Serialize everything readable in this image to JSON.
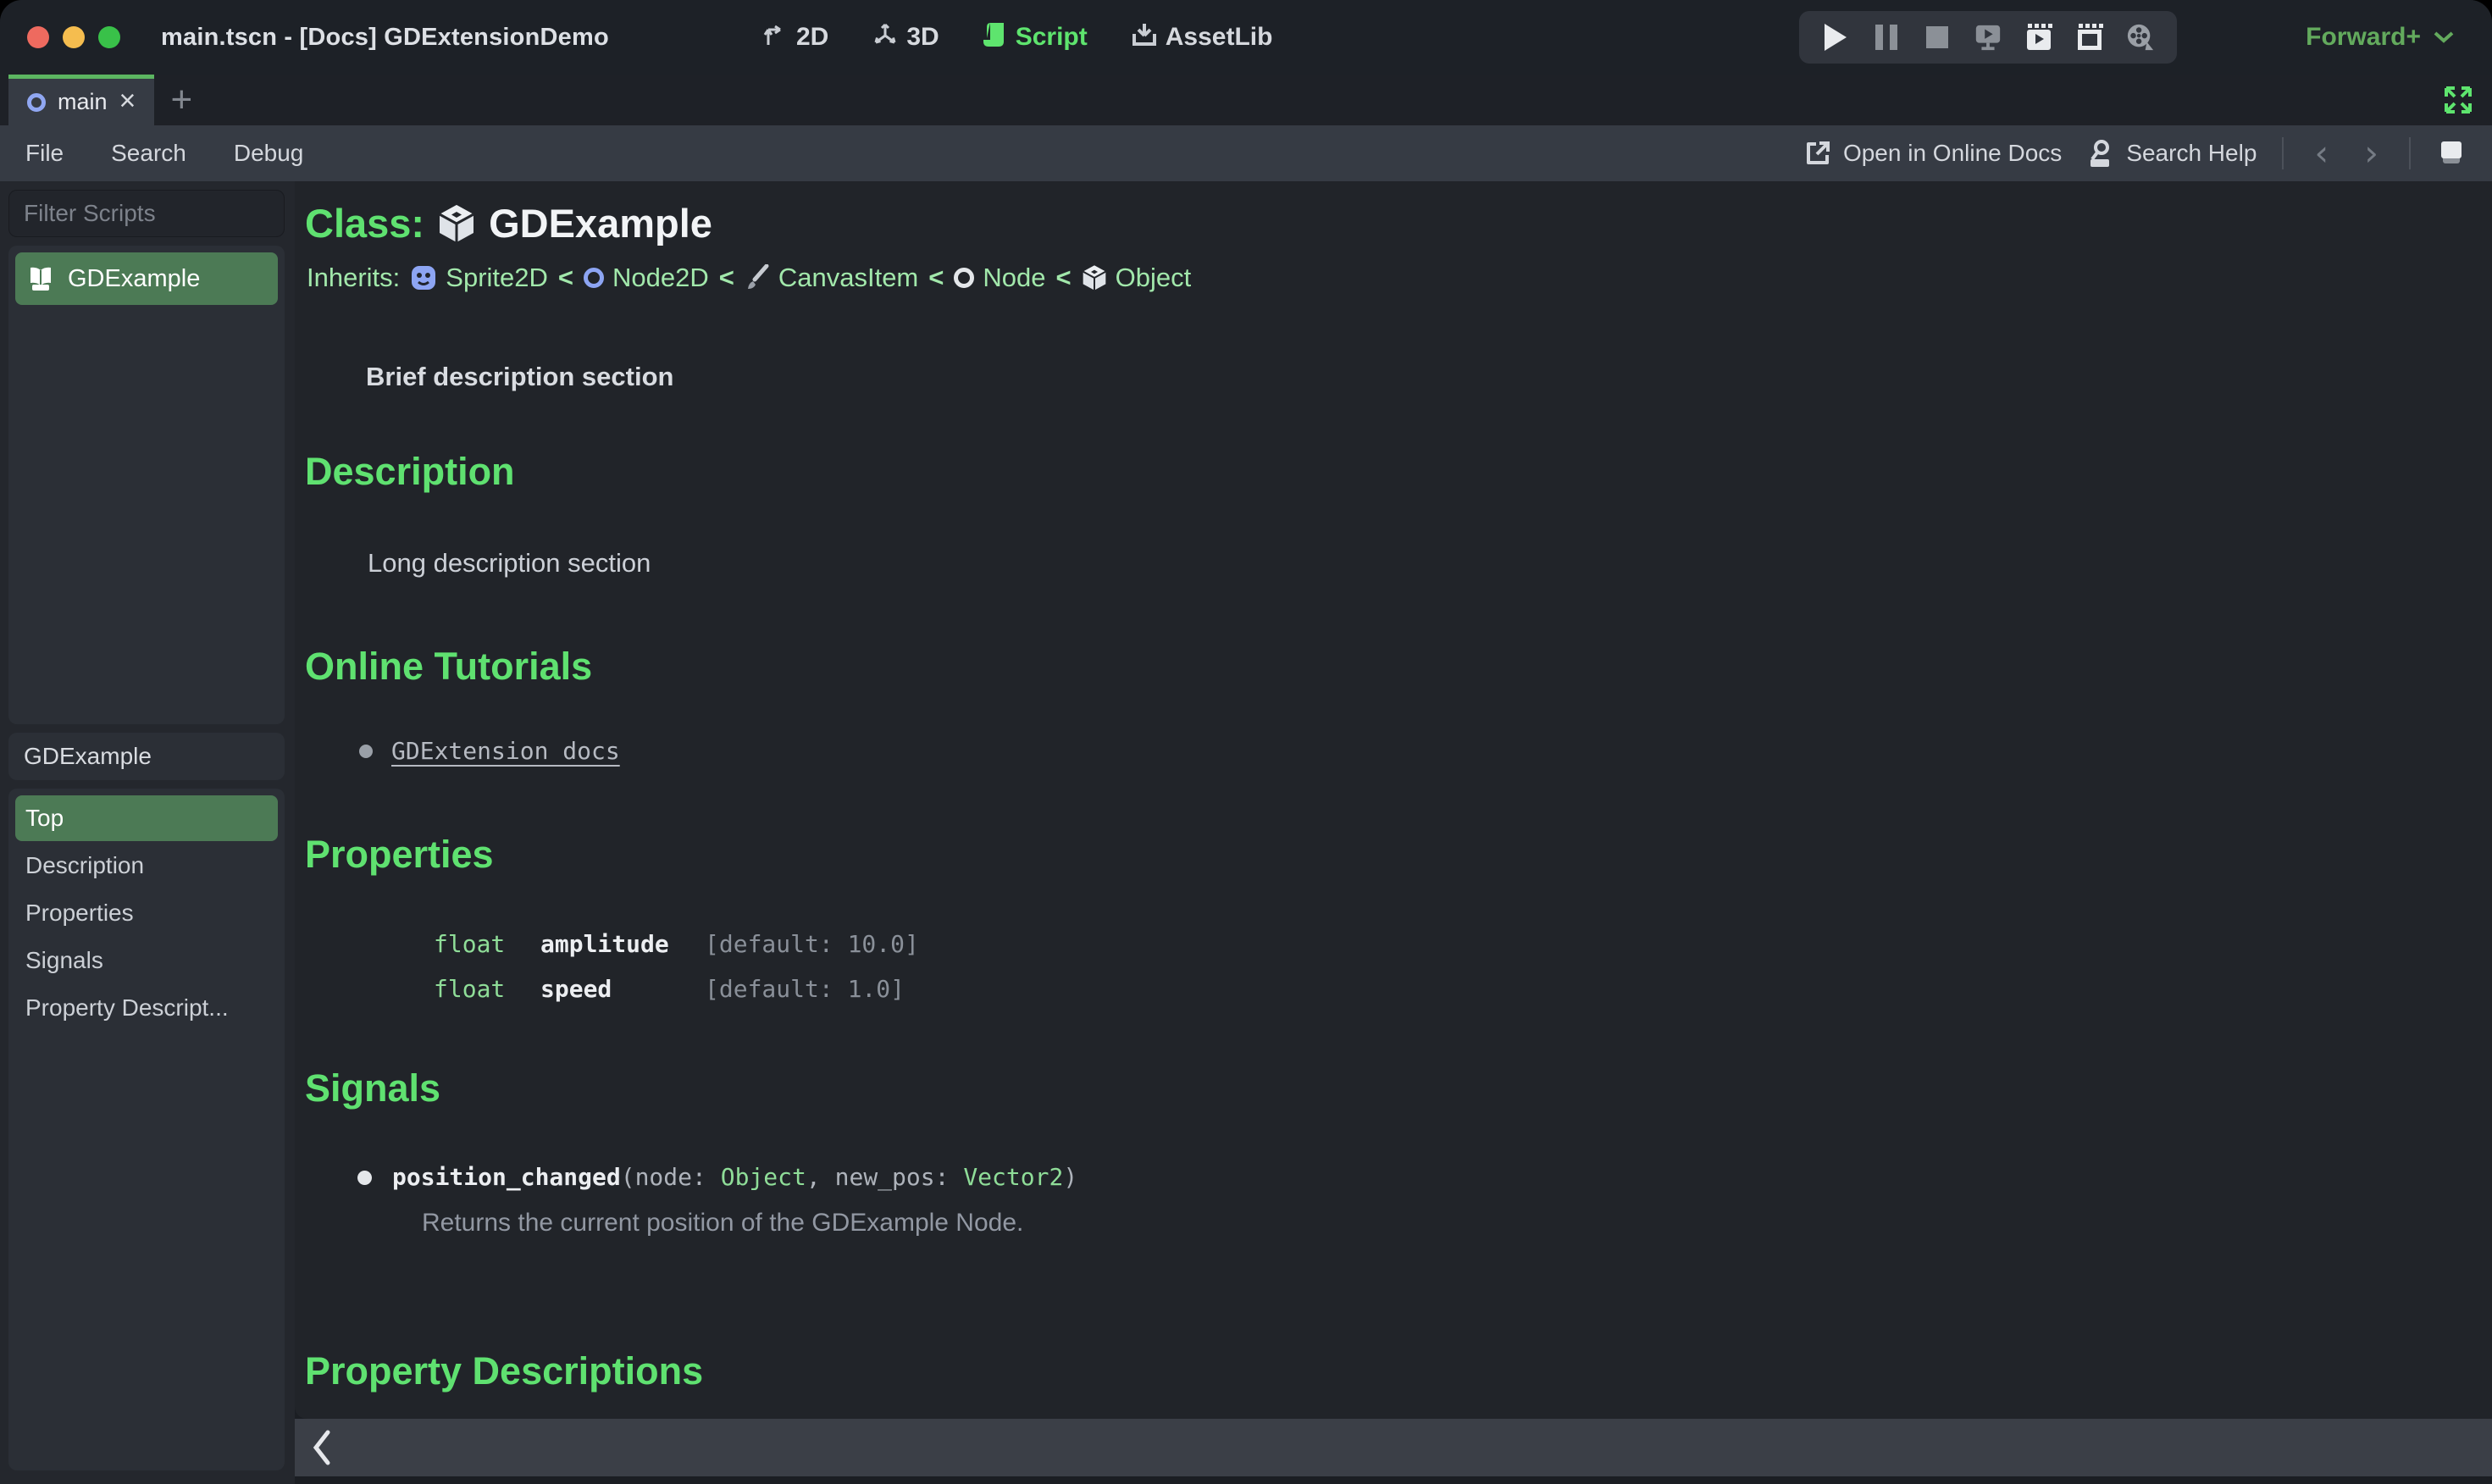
{
  "window": {
    "title": "main.tscn - [Docs] GDExtensionDemo"
  },
  "titlebar": {
    "workspaces": [
      {
        "label": "2D"
      },
      {
        "label": "3D"
      },
      {
        "label": "Script"
      },
      {
        "label": "AssetLib"
      }
    ],
    "renderer_label": "Forward+"
  },
  "tabbar": {
    "tabs": [
      {
        "label": "main"
      }
    ]
  },
  "menubar": {
    "items": [
      "File",
      "Search",
      "Debug"
    ],
    "open_online_docs": "Open in Online Docs",
    "search_help": "Search Help"
  },
  "sidebar": {
    "filter_placeholder": "Filter Scripts",
    "scripts": [
      {
        "label": "GDExample"
      }
    ],
    "member_panel_title": "GDExample",
    "members": [
      {
        "label": "Top"
      },
      {
        "label": "Description"
      },
      {
        "label": "Properties"
      },
      {
        "label": "Signals"
      },
      {
        "label": "Property Descript..."
      }
    ]
  },
  "doc": {
    "class_label": "Class:",
    "class_name": "GDExample",
    "inherits_label": "Inherits:",
    "inherits_chain": [
      {
        "name": "Sprite2D"
      },
      {
        "name": "Node2D"
      },
      {
        "name": "CanvasItem"
      },
      {
        "name": "Node"
      },
      {
        "name": "Object"
      }
    ],
    "chain_separator": "<",
    "brief": "Brief description section",
    "description_heading": "Description",
    "description_body": "Long description section",
    "tutorials_heading": "Online Tutorials",
    "tutorial_link": "GDExtension docs",
    "properties_heading": "Properties",
    "property_rows": [
      {
        "type": "float",
        "name": "amplitude",
        "default": "[default: 10.0]"
      },
      {
        "type": "float",
        "name": "speed",
        "default": "[default: 1.0]"
      }
    ],
    "signals_heading": "Signals",
    "signal": {
      "name": "position_changed",
      "part0": "(node: ",
      "part1": "Object",
      "part2": ", new_pos: ",
      "part3": "Vector2",
      "part4": ")",
      "description": "Returns the current position of the GDExample Node."
    },
    "property_descriptions_heading": "Property Descriptions"
  },
  "glyphs": {
    "close_tab": "×",
    "add_tab": "+",
    "nav_back": "‹",
    "nav_forward": "›"
  },
  "colors": {
    "accent_green": "#5fe170",
    "link_green": "#8fdd98",
    "selection_green": "#4c7a55",
    "panel_dark": "#212429",
    "menubar_bg": "#363b44"
  }
}
